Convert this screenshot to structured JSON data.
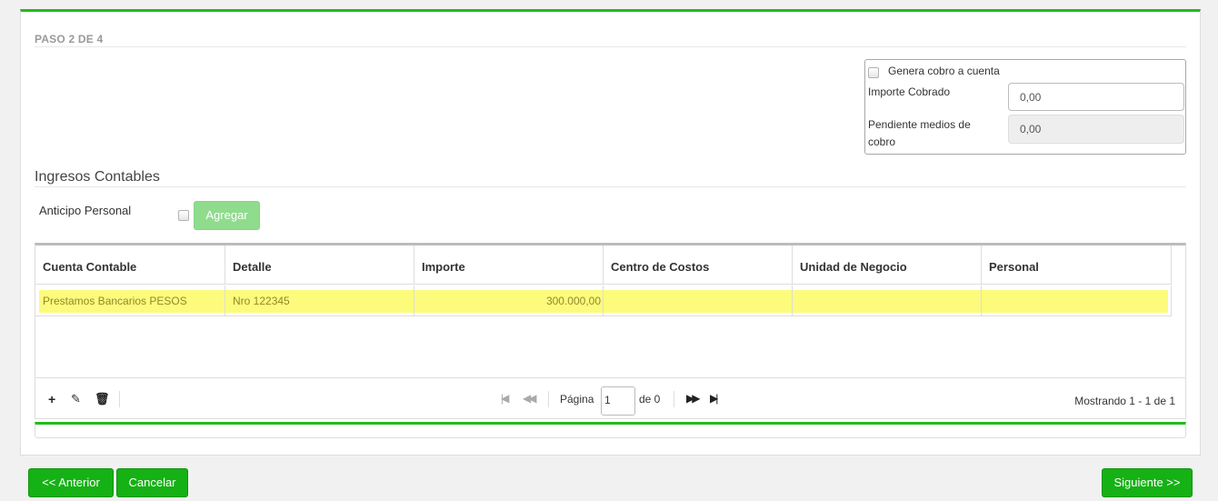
{
  "step_title": "PASO 2 DE 4",
  "cobro": {
    "genera_label": "Genera cobro a cuenta",
    "importe_label": "Importe Cobrado",
    "importe_value": "0,00",
    "pendiente_label": "Pendiente medios de cobro",
    "pendiente_value": "0,00"
  },
  "section_title": "Ingresos Contables",
  "anticipo": {
    "label": "Anticipo Personal",
    "agregar_label": "Agregar"
  },
  "grid": {
    "columns": [
      "Cuenta Contable",
      "Detalle",
      "Importe",
      "Centro de Costos",
      "Unidad de Negocio",
      "Personal"
    ],
    "rows": [
      [
        "Prestamos Bancarios PESOS",
        "Nro 122345",
        "300.000,00",
        "",
        "",
        ""
      ]
    ],
    "pager": {
      "add_icon": "plus-icon",
      "edit_icon": "pencil-icon",
      "delete_icon": "trash-icon",
      "pagina_label": "Página",
      "page_value": "1",
      "de_label": "de 0",
      "mostrando": "Mostrando 1 - 1 de 1"
    }
  },
  "buttons": {
    "anterior": "<< Anterior",
    "cancelar": "Cancelar",
    "siguiente": "Siguiente >>"
  },
  "colors": {
    "accent_green": "#22bb1f",
    "button_green": "#15b115",
    "row_highlight": "#fdfb7c"
  }
}
